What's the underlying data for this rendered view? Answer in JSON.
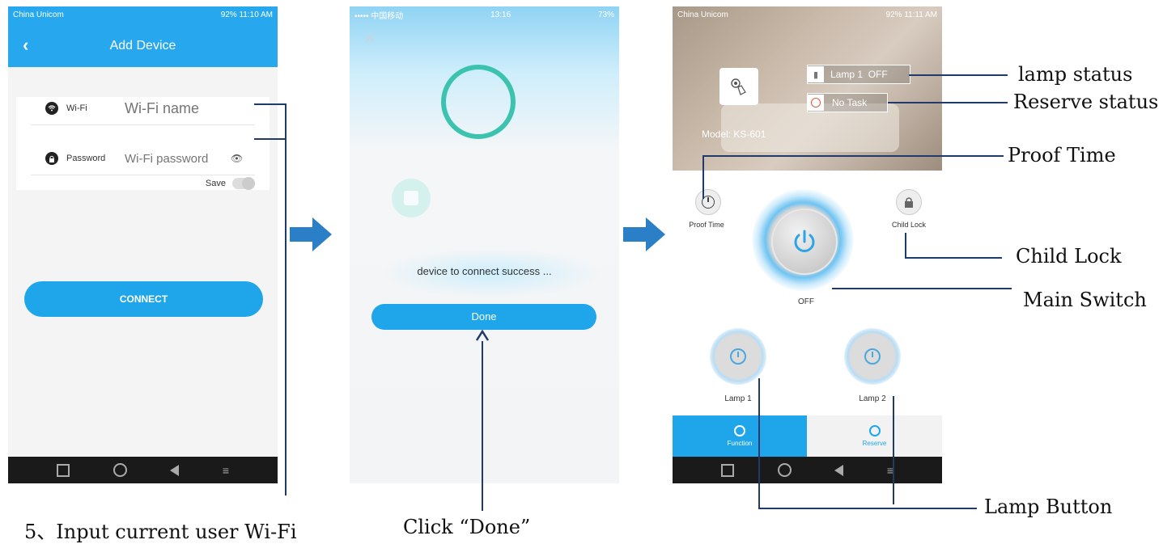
{
  "phone1": {
    "status_left": "China Unicom",
    "status_right": "92%  11:10 AM",
    "header_title": "Add Device",
    "wifi_label": "Wi-Fi",
    "wifi_placeholder": "Wi-Fi name",
    "password_label": "Password",
    "password_placeholder": "Wi-Fi password",
    "save_label": "Save",
    "connect_label": "CONNECT"
  },
  "phone2": {
    "status_left": "••••• 中国移动",
    "status_center": "13:16",
    "status_right": "73%",
    "success_text": "device to connect success ...",
    "done_label": "Done"
  },
  "phone3": {
    "status_left": "China Unicom",
    "status_right": "92%  11:11 AM",
    "lamp_status": "Lamp 1  OFF",
    "reserve_status": "No Task",
    "model_text": "Model: KS-601",
    "proof_time_label": "Proof Time",
    "child_lock_label": "Child Lock",
    "main_state": "OFF",
    "lamp1_label": "Lamp 1",
    "lamp2_label": "Lamp 2",
    "tab_function": "Function",
    "tab_reserve": "Reserve"
  },
  "annotations": {
    "lamp_status": "lamp status",
    "reserve_status": "Reserve status",
    "proof_time": "Proof Time",
    "child_lock": "Child Lock",
    "main_switch": "Main Switch",
    "lamp_button": "Lamp Button",
    "step5": "5、Input current  user Wi-Fi",
    "click_done": "Click “Done”"
  },
  "colors": {
    "primary_blue": "#1fa6ea",
    "header_blue": "#26a7ee",
    "annotation_line": "#1f3a6b",
    "arrow_blue": "#2a7fc7",
    "teal_ring": "#3cc3b0"
  }
}
